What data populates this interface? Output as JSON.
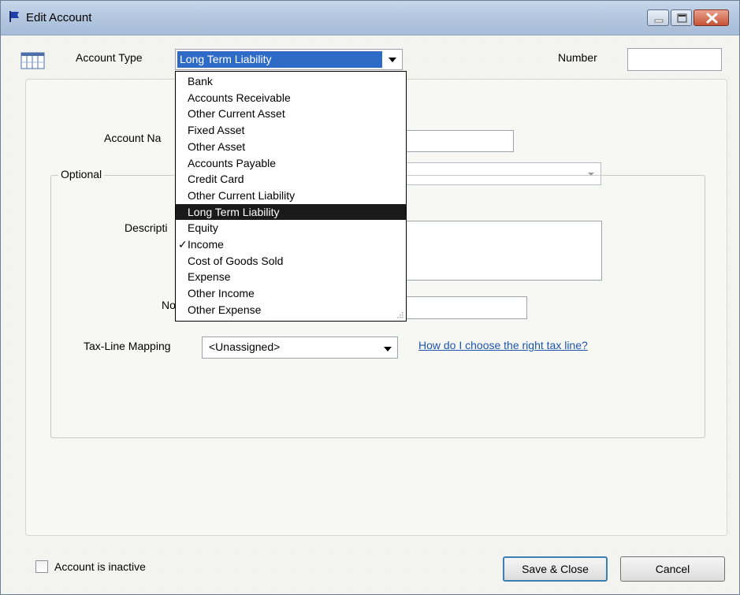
{
  "window": {
    "title": "Edit Account",
    "controls": [
      "minimize-icon",
      "maximize-icon",
      "close-icon"
    ]
  },
  "header": {
    "account_type_label": "Account Type",
    "account_type_value": "Long Term Liability",
    "number_label": "Number",
    "number_value": ""
  },
  "form": {
    "account_name_label": "Account Na",
    "account_name_value": "",
    "subaccount_value": "",
    "optional_label": "Optional",
    "description_label": "Descripti",
    "description_value": "",
    "note_label": "No",
    "note_value": "",
    "tax_line_label": "Tax-Line Mapping",
    "tax_line_value": "<Unassigned>",
    "tax_help_link": "How do I choose the right tax line?"
  },
  "account_type_options": [
    {
      "label": "Bank",
      "selected": false,
      "checked": false
    },
    {
      "label": "Accounts Receivable",
      "selected": false,
      "checked": false
    },
    {
      "label": "Other Current Asset",
      "selected": false,
      "checked": false
    },
    {
      "label": "Fixed Asset",
      "selected": false,
      "checked": false
    },
    {
      "label": "Other Asset",
      "selected": false,
      "checked": false
    },
    {
      "label": "Accounts Payable",
      "selected": false,
      "checked": false
    },
    {
      "label": "Credit Card",
      "selected": false,
      "checked": false
    },
    {
      "label": "Other Current Liability",
      "selected": false,
      "checked": false
    },
    {
      "label": "Long Term Liability",
      "selected": true,
      "checked": false
    },
    {
      "label": "Equity",
      "selected": false,
      "checked": false
    },
    {
      "label": "Income",
      "selected": false,
      "checked": true
    },
    {
      "label": "Cost of Goods Sold",
      "selected": false,
      "checked": false
    },
    {
      "label": "Expense",
      "selected": false,
      "checked": false
    },
    {
      "label": "Other Income",
      "selected": false,
      "checked": false
    },
    {
      "label": "Other Expense",
      "selected": false,
      "checked": false
    }
  ],
  "footer": {
    "inactive_label": "Account is inactive",
    "inactive_checked": false,
    "save_close_label": "Save & Close",
    "cancel_label": "Cancel"
  },
  "colors": {
    "selection": "#1a1a1a",
    "combo_highlight": "#2e6bc7",
    "link": "#1c55b0"
  }
}
